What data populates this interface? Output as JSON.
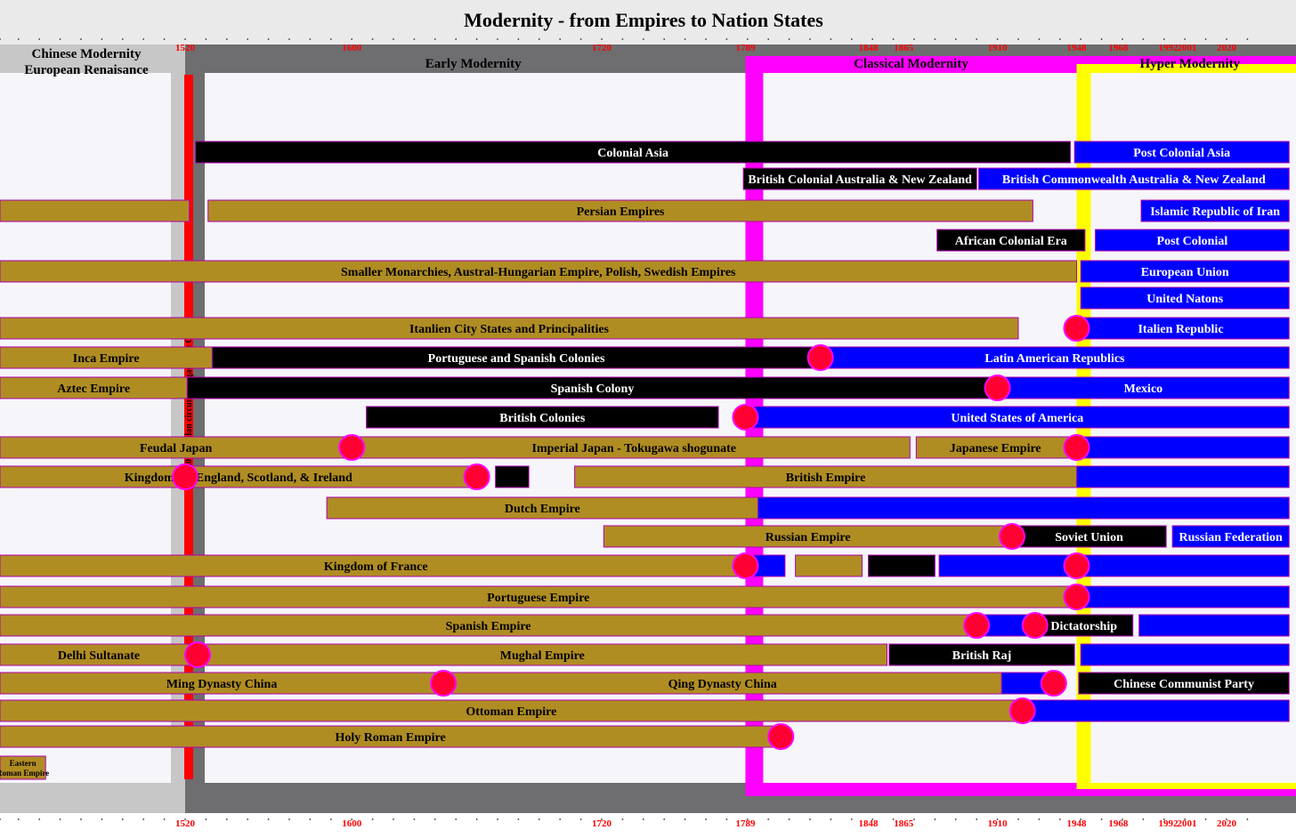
{
  "chart_data": {
    "type": "timeline",
    "title": "Modernity - from Empires to Nation States",
    "x_domain": [
      1430,
      2050
    ],
    "axis_labels": [
      "1520",
      "1600",
      "1720",
      "1789",
      "1848",
      "1865",
      "1910",
      "1948",
      "1968",
      "1992",
      "2001",
      "2020"
    ],
    "eras": [
      {
        "name": "Chinese Modernity",
        "name2": "European Renaisance",
        "start": 1430,
        "end": 1520,
        "color": "#c8c7c7"
      },
      {
        "name": "Early Modernity",
        "start": 1520,
        "end": 1789,
        "color": "#6e6d6f"
      },
      {
        "name": "Classical Modernity",
        "start": 1789,
        "end": 1948,
        "color": "#ff00ff"
      },
      {
        "name": "Hyper Modernity",
        "start": 1948,
        "end": 2050,
        "color": "#ffff00"
      }
    ],
    "magellan": {
      "year": 1520,
      "label": "1520 Magelan circumnavigates the Globe"
    },
    "colors": {
      "empire": "#b08d23",
      "colonial": "#000000",
      "nation_state": "#0000ff",
      "transition": "#ff0033",
      "axis_red": "#ff0000"
    },
    "rows": [
      {
        "bars": [
          {
            "label": "Colonial Asia",
            "start": 1525,
            "end": 1945,
            "kind": "colonial"
          },
          {
            "label": "Post Colonial Asia",
            "start": 1947,
            "end": 2050,
            "kind": "nation_state"
          }
        ]
      },
      {
        "bars": [
          {
            "label": "British Colonial Australia & New Zealand",
            "start": 1788,
            "end": 1900,
            "kind": "colonial"
          },
          {
            "label": "British Commonwealth Australia & New Zealand",
            "start": 1901,
            "end": 2050,
            "kind": "nation_state"
          }
        ]
      },
      {
        "bars": [
          {
            "label": "",
            "start": 1430,
            "end": 1522,
            "kind": "empire"
          },
          {
            "label": "Persian Empires",
            "start": 1531,
            "end": 1927,
            "kind": "empire"
          },
          {
            "label": "Islamic Republic of Iran",
            "start": 1979,
            "end": 2050,
            "kind": "nation_state"
          }
        ]
      },
      {
        "bars": [
          {
            "label": "African Colonial Era",
            "start": 1881,
            "end": 1952,
            "kind": "colonial"
          },
          {
            "label": "Post Colonial",
            "start": 1957,
            "end": 2050,
            "kind": "nation_state"
          }
        ]
      },
      {
        "bars": [
          {
            "label": "Smaller Monarchies, Austral-Hungarian Empire, Polish, Swedish Empires",
            "start": 1430,
            "end": 1948,
            "kind": "empire"
          },
          {
            "label": "European Union",
            "start": 1950,
            "end": 2050,
            "kind": "nation_state"
          }
        ]
      },
      {
        "bars": [
          {
            "label": "United Natons",
            "start": 1950,
            "end": 2050,
            "kind": "nation_state"
          }
        ]
      },
      {
        "bars": [
          {
            "label": "Itanlien City States and Principalities",
            "start": 1430,
            "end": 1920,
            "kind": "empire"
          },
          {
            "label": "Italien Republic",
            "start": 1946,
            "end": 2050,
            "kind": "nation_state"
          }
        ]
      },
      {
        "bars": [
          {
            "label": "Inca Empire",
            "start": 1430,
            "end": 1533,
            "kind": "empire"
          },
          {
            "label": "Portuguese and Spanish Colonies",
            "start": 1533,
            "end": 1825,
            "kind": "colonial"
          },
          {
            "label": "Latin American Republics",
            "start": 1825,
            "end": 2050,
            "kind": "nation_state"
          }
        ]
      },
      {
        "bars": [
          {
            "label": "Aztec Empire",
            "start": 1430,
            "end": 1521,
            "kind": "empire"
          },
          {
            "label": "Spanish Colony",
            "start": 1521,
            "end": 1910,
            "kind": "colonial"
          },
          {
            "label": "Mexico",
            "start": 1910,
            "end": 2050,
            "kind": "nation_state"
          }
        ]
      },
      {
        "bars": [
          {
            "label": "British Colonies",
            "start": 1607,
            "end": 1776,
            "kind": "colonial"
          },
          {
            "label": "United States of America",
            "start": 1789,
            "end": 2050,
            "kind": "nation_state"
          }
        ]
      },
      {
        "bars": [
          {
            "label": "Feudal Japan",
            "start": 1430,
            "end": 1600,
            "kind": "empire"
          },
          {
            "label": "Imperial Japan - Tokugawa shogunate",
            "start": 1603,
            "end": 1868,
            "kind": "empire"
          },
          {
            "label": "Japanese Empire",
            "start": 1871,
            "end": 1947,
            "kind": "empire"
          },
          {
            "label": "",
            "start": 1948,
            "end": 2050,
            "kind": "nation_state"
          }
        ]
      },
      {
        "bars": [
          {
            "label": "Kingdoms of England, Scotland, & Ireland",
            "start": 1430,
            "end": 1660,
            "kind": "empire"
          },
          {
            "label": "",
            "start": 1669,
            "end": 1685,
            "kind": "colonial"
          },
          {
            "label": "British Empire",
            "start": 1707,
            "end": 1948,
            "kind": "empire"
          },
          {
            "label": "",
            "start": 1948,
            "end": 2050,
            "kind": "nation_state"
          }
        ]
      },
      {
        "bars": [
          {
            "label": "Dutch Empire",
            "start": 1588,
            "end": 1795,
            "kind": "empire"
          },
          {
            "label": "",
            "start": 1795,
            "end": 2050,
            "kind": "nation_state"
          }
        ]
      },
      {
        "bars": [
          {
            "label": "Russian Empire",
            "start": 1721,
            "end": 1917,
            "kind": "empire"
          },
          {
            "label": "Soviet Union",
            "start": 1917,
            "end": 1991,
            "kind": "colonial"
          },
          {
            "label": "Russian Federation",
            "start": 1994,
            "end": 2050,
            "kind": "nation_state"
          }
        ]
      },
      {
        "bars": [
          {
            "label": "Kingdom of France",
            "start": 1430,
            "end": 1792,
            "kind": "empire"
          },
          {
            "label": "",
            "start": 1792,
            "end": 1808,
            "kind": "nation_state"
          },
          {
            "label": "",
            "start": 1813,
            "end": 1845,
            "kind": "empire"
          },
          {
            "label": "",
            "start": 1848,
            "end": 1880,
            "kind": "colonial"
          },
          {
            "label": "",
            "start": 1882,
            "end": 1948,
            "kind": "nation_state"
          },
          {
            "label": "",
            "start": 1948,
            "end": 2050,
            "kind": "nation_state"
          }
        ]
      },
      {
        "bars": [
          {
            "label": "Portuguese Empire",
            "start": 1430,
            "end": 1948,
            "kind": "empire"
          },
          {
            "label": "",
            "start": 1948,
            "end": 2050,
            "kind": "nation_state"
          }
        ]
      },
      {
        "bars": [
          {
            "label": "Spanish Empire",
            "start": 1430,
            "end": 1900,
            "kind": "empire"
          },
          {
            "label": "",
            "start": 1900,
            "end": 1928,
            "kind": "nation_state"
          },
          {
            "label": "Dictatorship",
            "start": 1928,
            "end": 1975,
            "kind": "colonial"
          },
          {
            "label": "",
            "start": 1978,
            "end": 2050,
            "kind": "nation_state"
          }
        ]
      },
      {
        "bars": [
          {
            "label": "Delhi Sultanate",
            "start": 1430,
            "end": 1526,
            "kind": "empire"
          },
          {
            "label": "Mughal Empire",
            "start": 1526,
            "end": 1857,
            "kind": "empire"
          },
          {
            "label": "British Raj",
            "start": 1858,
            "end": 1947,
            "kind": "colonial"
          },
          {
            "label": "",
            "start": 1950,
            "end": 2050,
            "kind": "nation_state"
          }
        ]
      },
      {
        "bars": [
          {
            "label": "Ming Dynasty China",
            "start": 1430,
            "end": 1644,
            "kind": "empire"
          },
          {
            "label": "Qing Dynasty China",
            "start": 1644,
            "end": 1912,
            "kind": "empire"
          },
          {
            "label": "",
            "start": 1912,
            "end": 1937,
            "kind": "nation_state"
          },
          {
            "label": "Chinese Communist Party",
            "start": 1949,
            "end": 2050,
            "kind": "colonial"
          }
        ]
      },
      {
        "bars": [
          {
            "label": "Ottoman Empire",
            "start": 1430,
            "end": 1922,
            "kind": "empire"
          },
          {
            "label": "",
            "start": 1923,
            "end": 2050,
            "kind": "nation_state"
          }
        ]
      },
      {
        "bars": [
          {
            "label": "Holy Roman Empire",
            "start": 1430,
            "end": 1806,
            "kind": "empire"
          }
        ]
      },
      {
        "bars": [
          {
            "label": "Eastern",
            "label2": "Roman Empire",
            "start": 1430,
            "end": 1453,
            "kind": "empire"
          }
        ]
      }
    ],
    "transitions": [
      {
        "year": 1948,
        "row": 6
      },
      {
        "year": 1825,
        "row": 7
      },
      {
        "year": 1910,
        "row": 8
      },
      {
        "year": 1789,
        "row": 9
      },
      {
        "year": 1600,
        "row": 10
      },
      {
        "year": 1948,
        "row": 10
      },
      {
        "year": 1520,
        "row": 11
      },
      {
        "year": 1660,
        "row": 11
      },
      {
        "year": 1917,
        "row": 13
      },
      {
        "year": 1789,
        "row": 14
      },
      {
        "year": 1948,
        "row": 14
      },
      {
        "year": 1948,
        "row": 15
      },
      {
        "year": 1900,
        "row": 16
      },
      {
        "year": 1928,
        "row": 16
      },
      {
        "year": 1526,
        "row": 17
      },
      {
        "year": 1644,
        "row": 18
      },
      {
        "year": 1937,
        "row": 18
      },
      {
        "year": 1922,
        "row": 19
      },
      {
        "year": 1806,
        "row": 20
      }
    ]
  }
}
